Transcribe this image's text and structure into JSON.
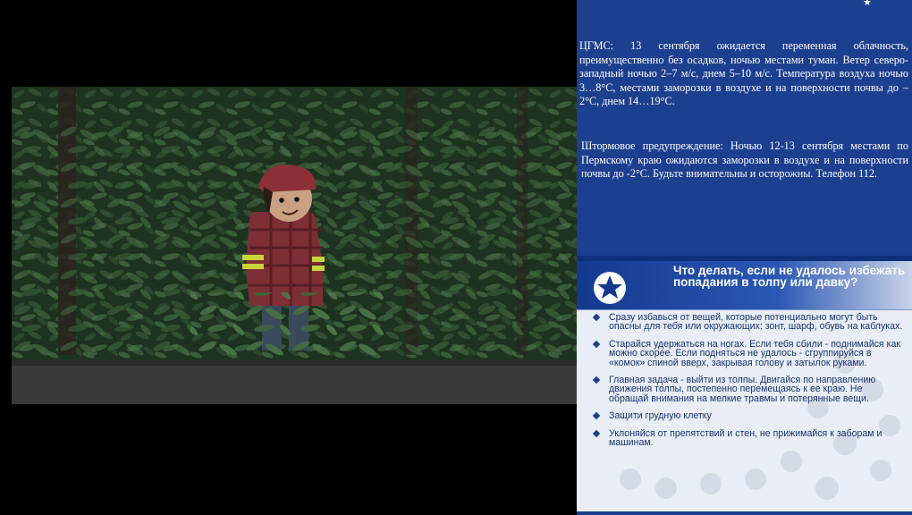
{
  "video": {
    "scene": "animated-forest-character"
  },
  "weather_panel": {
    "forecast": "ЦГМС: 13 сентября ожидается переменная облачность, преимущественно без осадков, ночью местами туман. Ветер северо-западный ночью 2–7 м/с, днем 5–10 м/с. Температура воздуха ночью 3…8°С, местами заморозки в воздухе и на поверхности почвы до –2°С, днем 14…19°С.",
    "warning": "Штормовое предупреждение: Ночью 12-13 сентября местами по Пермскому краю ожидаются заморозки в воздухе и на поверхности почвы до -2°С. Будьте внимательны и осторожны. Телефон 112.",
    "background": "#1d3f8f"
  },
  "tips_panel": {
    "title": "Что делать, если не удалось избежать попадания в толпу или давку?",
    "items": [
      "Сразу избавься от вещей, которые потенциально могут быть опасны для тебя или окружающих: зонт, шарф, обувь на каблуках.",
      "Старайся удержаться на ногах. Если тебя сбили - поднимайся как можно скорее. Если подняться не удалось - сгруппируйся в «комок» спиной вверх, закрывая голову и затылок руками.",
      "Главная задача - выйти из толпы. Двигайся по направлению движения толпы, постепенно перемещаясь к ее краю. Не обращай внимания на мелкие травмы и потерянные вещи.",
      "Защити грудную клетку",
      "Уклоняйся от препятствий и стен, не прижимайся к заборам и машинам."
    ],
    "accent": "#13398f",
    "text_color": "#18336e"
  }
}
